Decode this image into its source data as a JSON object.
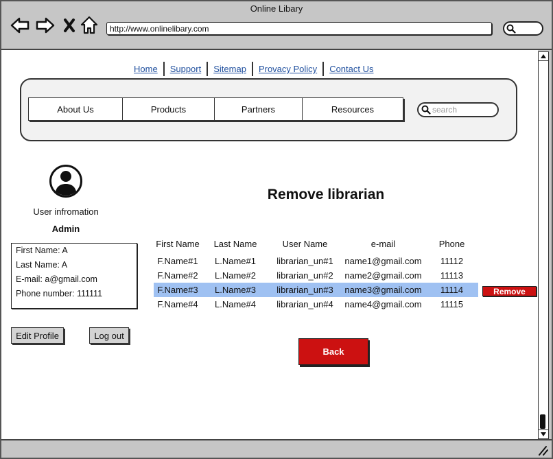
{
  "window": {
    "title": "Online Libary"
  },
  "browser": {
    "url": "http://www.onlinelibary.com",
    "nav_icons": [
      "back-arrow-icon",
      "forward-arrow-icon",
      "close-icon",
      "home-icon"
    ]
  },
  "top_links": [
    {
      "label": "Home"
    },
    {
      "label": "Support"
    },
    {
      "label": "Sitemap"
    },
    {
      "label": "Provacy Policy"
    },
    {
      "label": "Contact Us"
    }
  ],
  "nav_tabs": [
    {
      "label": "About Us"
    },
    {
      "label": "Products"
    },
    {
      "label": "Partners"
    },
    {
      "label": "Resources"
    }
  ],
  "site_search": {
    "placeholder": "search",
    "icon": "search-icon"
  },
  "user_panel": {
    "avatar_icon": "user-avatar-icon",
    "heading": "User infromation",
    "role": "Admin",
    "details": [
      "First Name: A",
      "Last Name: A",
      "E-mail: a@gmail.com",
      "Phone number: 111111"
    ],
    "edit_label": "Edit Profile",
    "logout_label": "Log out"
  },
  "main": {
    "title": "Remove librarian",
    "table": {
      "columns": [
        "First Name",
        "Last Name",
        "User Name",
        "e-mail",
        "Phone"
      ],
      "rows": [
        {
          "cells": [
            "F.Name#1",
            "L.Name#1",
            "librarian_un#1",
            "name1@gmail.com",
            "11112"
          ],
          "selected": false
        },
        {
          "cells": [
            "F.Name#2",
            "L.Name#2",
            "librarian_un#2",
            "name2@gmail.com",
            "11113"
          ],
          "selected": false
        },
        {
          "cells": [
            "F.Name#3",
            "L.Name#3",
            "librarian_un#3",
            "name3@gmail.com",
            "11114"
          ],
          "selected": true
        },
        {
          "cells": [
            "F.Name#4",
            "L.Name#4",
            "librarian_un#4",
            "name4@gmail.com",
            "11115"
          ],
          "selected": false
        }
      ]
    },
    "remove_label": "Remove",
    "back_label": "Back"
  },
  "colors": {
    "chrome": "#c6c6c6",
    "link": "#1f4f9e",
    "selection": "#9fc1f2",
    "danger": "#cc1111"
  }
}
